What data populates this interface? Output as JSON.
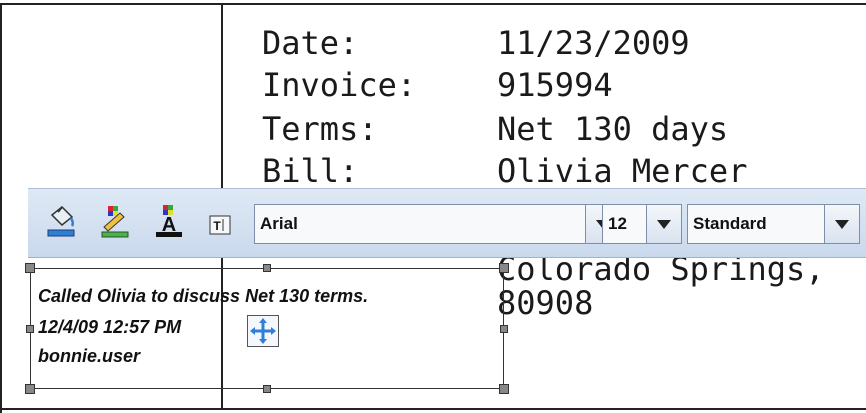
{
  "document": {
    "fields": [
      {
        "label": "Date:",
        "value": "11/23/2009"
      },
      {
        "label": "Invoice:",
        "value": "915994"
      },
      {
        "label": "Terms:",
        "value": "Net 130 days"
      },
      {
        "label": "Bill:",
        "value": "Olivia Mercer"
      }
    ],
    "partial_address_line": "Colorado Springs,",
    "zip": "80908"
  },
  "toolbar": {
    "fill_color_icon": "paint-bucket-icon",
    "line_color_icon": "line-color-icon",
    "text_color_icon": "text-color-icon",
    "text_box_icon": "text-box-icon",
    "font_family": "Arial",
    "font_size": "12",
    "font_style": "Standard"
  },
  "annotation": {
    "lines": [
      "Called Olivia to discuss Net 130 terms.",
      "12/4/09 12:57 PM",
      "bonnie.user"
    ],
    "move_icon": "move-arrows-icon"
  },
  "colors": {
    "toolbar_bg": "#c9d9ec",
    "accent_blue": "#2f7fd6"
  }
}
